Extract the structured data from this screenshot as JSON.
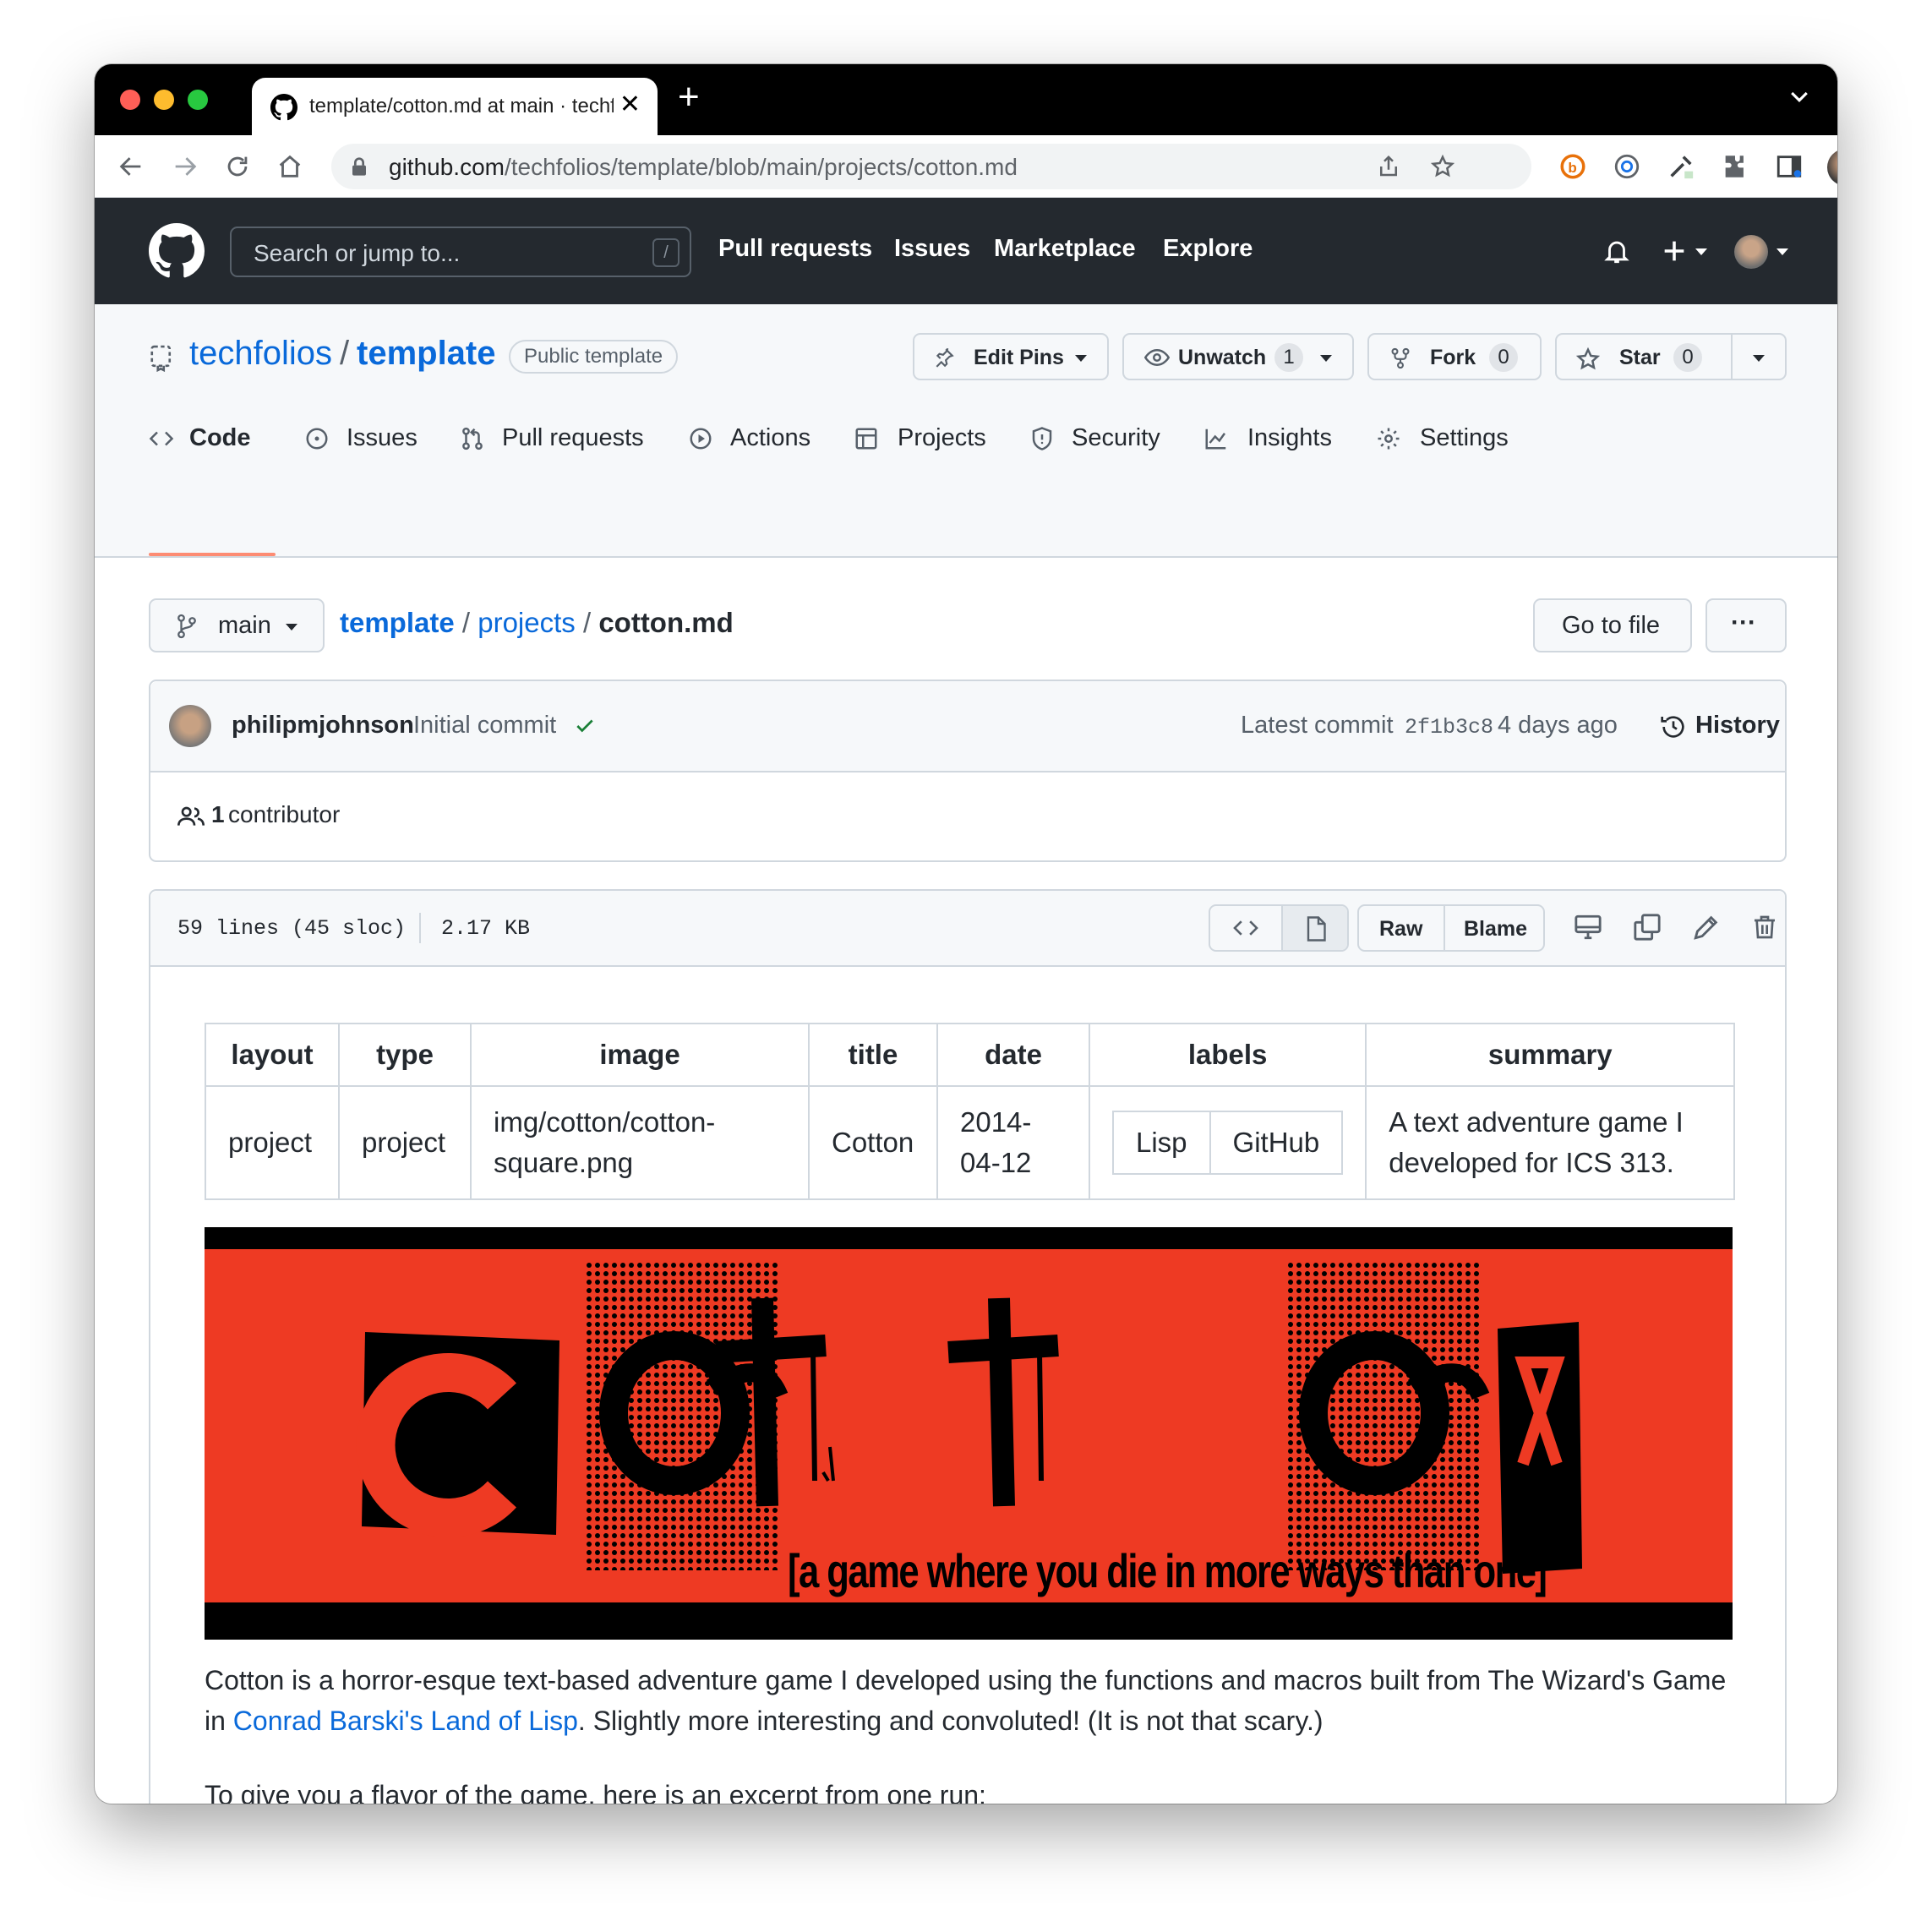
{
  "browser": {
    "tab_title": "template/cotton.md at main · techfolios/template",
    "url_host": "github.com",
    "url_path": "/techfolios/template/blob/main/projects/cotton.md",
    "traffic_colors": [
      "#ff5f57",
      "#febc2e",
      "#28c840"
    ]
  },
  "header": {
    "search_placeholder": "Search or jump to...",
    "search_shortcut": "/",
    "nav": [
      "Pull requests",
      "Issues",
      "Marketplace",
      "Explore"
    ]
  },
  "repo": {
    "owner": "techfolios",
    "separator": "/",
    "name": "template",
    "badge": "Public template",
    "edit_pins_label": "Edit Pins",
    "unwatch_label": "Unwatch",
    "unwatch_count": "1",
    "fork_label": "Fork",
    "fork_count": "0",
    "star_label": "Star",
    "star_count": "0",
    "tabs": [
      "Code",
      "Issues",
      "Pull requests",
      "Actions",
      "Projects",
      "Security",
      "Insights",
      "Settings"
    ]
  },
  "file_nav": {
    "branch": "main",
    "crumb_repo": "template",
    "crumb_dir": "projects",
    "crumb_file": "cotton.md",
    "sep": "/",
    "go_to_file": "Go to file",
    "more": "···"
  },
  "commit": {
    "author": "philipmjohnson",
    "message": "Initial commit",
    "latest_label": "Latest commit",
    "sha": "2f1b3c8",
    "age": "4 days ago",
    "history_label": "History",
    "contributors_count": "1",
    "contributors_label": "contributor"
  },
  "file": {
    "lines": "59 lines (45 sloc)",
    "size": "2.17 KB",
    "raw_label": "Raw",
    "blame_label": "Blame"
  },
  "frontmatter": {
    "headers": [
      "layout",
      "type",
      "image",
      "title",
      "date",
      "labels",
      "summary"
    ],
    "layout": "project",
    "type": "project",
    "image_line1": "img/cotton/cotton-",
    "image_line2": "square.png",
    "title": "Cotton",
    "date_line1": "2014-",
    "date_line2": "04-12",
    "labels": [
      "Lisp",
      "GitHub"
    ],
    "summary_line1": "A text adventure game I",
    "summary_line2": "developed for ICS 313."
  },
  "banner": {
    "logo_text": "cotton",
    "tagline": "[a game where you die in more ways than one]"
  },
  "body": {
    "para1_before": "Cotton is a horror-esque text-based adventure game I developed using the functions and macros built from The Wizard's Game in ",
    "para1_link": "Conrad Barski's Land of Lisp",
    "para1_after": ". Slightly more interesting and convoluted! (It is not that scary.)",
    "para2": "To give you a flavor of the game, here is an excerpt from one run:"
  }
}
